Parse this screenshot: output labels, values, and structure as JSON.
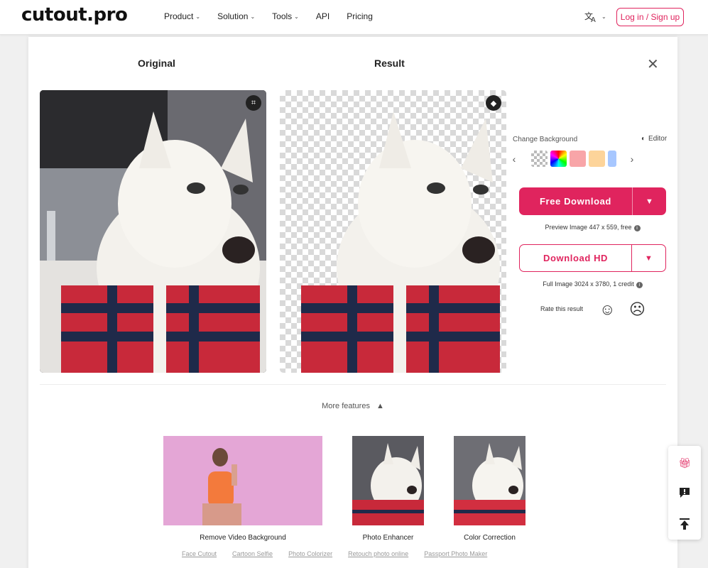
{
  "header": {
    "logo": "cutout.pro",
    "nav": [
      {
        "label": "Product",
        "has_menu": true
      },
      {
        "label": "Solution",
        "has_menu": true
      },
      {
        "label": "Tools",
        "has_menu": true
      },
      {
        "label": "API",
        "has_menu": false
      },
      {
        "label": "Pricing",
        "has_menu": false
      }
    ],
    "lang_icon": "translate-icon",
    "login_label": "Log in / Sign up"
  },
  "main": {
    "original_title": "Original",
    "result_title": "Result",
    "change_background_label": "Change Background",
    "editor_label": "Editor",
    "free_download_label": "Free Download",
    "preview_note": "Preview Image 447 x 559, free",
    "download_hd_label": "Download HD",
    "full_note": "Full Image 3024 x 3780, 1 credit",
    "rate_label": "Rate this result"
  },
  "more": {
    "toggle_label": "More features",
    "features": [
      {
        "label": "Remove Video Background"
      },
      {
        "label": "Photo Enhancer"
      },
      {
        "label": "Color Correction"
      }
    ],
    "links": [
      "Face Cutout",
      "Cartoon Selfie",
      "Photo Colorizer",
      "Retouch photo online",
      "Passport Photo Maker"
    ]
  },
  "colors": {
    "accent": "#e0245e",
    "swatches": [
      "transparent",
      "rainbow",
      "#f8a5a8",
      "#fdd49a",
      "#a7c7ff"
    ]
  }
}
